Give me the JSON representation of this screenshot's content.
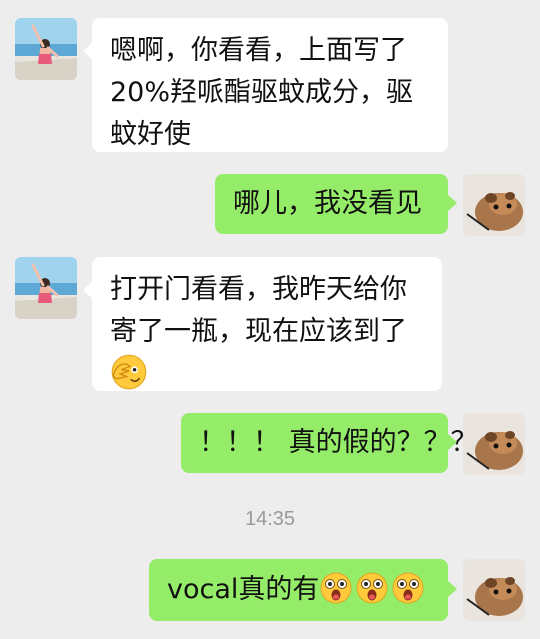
{
  "messages": [
    {
      "side": "in",
      "lines": [
        "嗯啊，你看看，上面写了",
        "20%羟哌酯驱蚊成分，驱",
        "蚊好使"
      ]
    },
    {
      "side": "out",
      "text": "哪儿，我没看见"
    },
    {
      "side": "in",
      "lines": [
        "打开门看看，我昨天给你",
        "寄了一瓶，现在应该到了"
      ],
      "emoji": "facepalm-peek-emoji"
    },
    {
      "side": "out",
      "text": "！！！ 真的假的？？？"
    },
    {
      "side": "out",
      "text": "vocal真的有",
      "emojis": [
        "shocked-face-emoji",
        "shocked-face-emoji",
        "shocked-face-emoji"
      ]
    }
  ],
  "timestamp": "14:35",
  "colors": {
    "background": "#ededed",
    "incoming_bubble": "#ffffff",
    "outgoing_bubble": "#95ec69",
    "timestamp_text": "#9a9a9a"
  },
  "avatars": {
    "contact": "girl-on-boat-avatar",
    "self": "hamster-avatar"
  }
}
